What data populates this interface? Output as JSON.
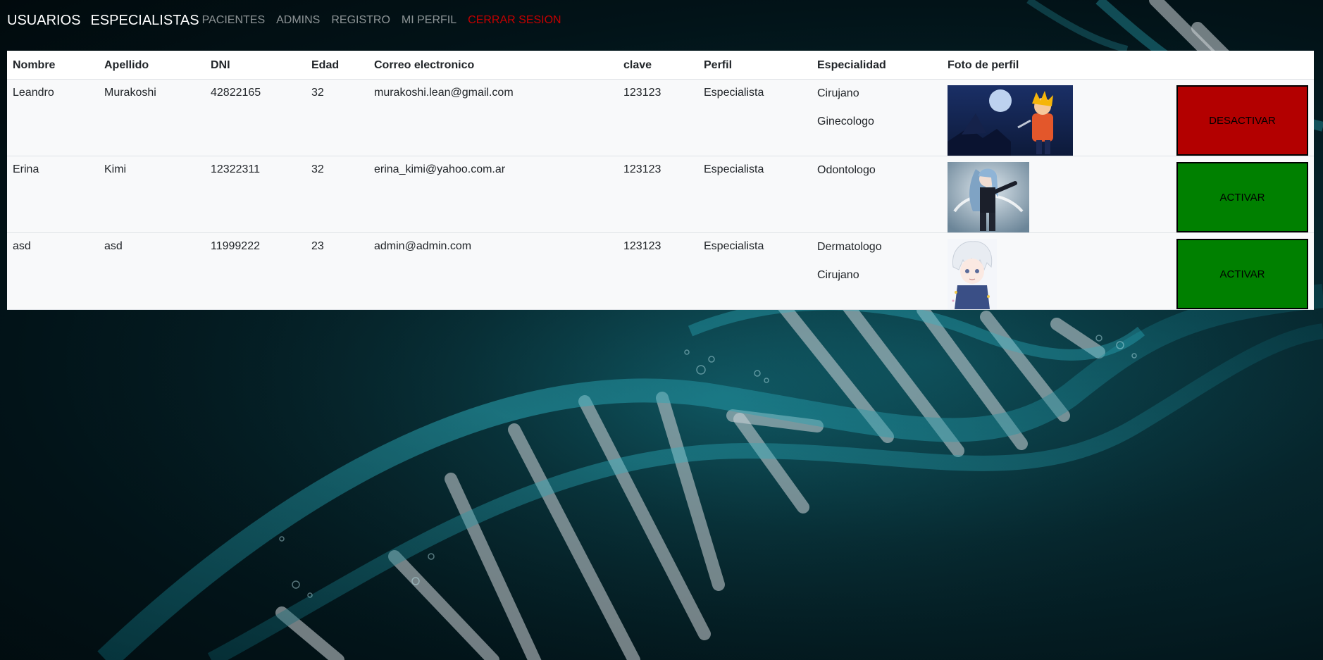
{
  "nav": {
    "brand": "USUARIOS",
    "specialists": "ESPECIALISTAS",
    "links": [
      "PACIENTES",
      "ADMINS",
      "REGISTRO",
      "MI PERFIL"
    ],
    "logout": "CERRAR SESION"
  },
  "table": {
    "headers": [
      "Nombre",
      "Apellido",
      "DNI",
      "Edad",
      "Correo electronico",
      "clave",
      "Perfil",
      "Especialidad",
      "Foto de perfil"
    ],
    "rows": [
      {
        "nombre": "Leandro",
        "apellido": "Murakoshi",
        "dni": "42822165",
        "edad": "32",
        "correo": "murakoshi.lean@gmail.com",
        "clave": "123123",
        "perfil": "Especialista",
        "especialidades": [
          "Cirujano",
          "Ginecologo"
        ],
        "photo_icon": "avatar-anime-orange-hair",
        "action": "DESACTIVAR",
        "action_color": "#b30000"
      },
      {
        "nombre": "Erina",
        "apellido": "Kimi",
        "dni": "12322311",
        "edad": "32",
        "correo": "erina_kimi@yahoo.com.ar",
        "clave": "123123",
        "perfil": "Especialista",
        "especialidades": [
          "Odontologo"
        ],
        "photo_icon": "avatar-anime-silver-hair",
        "action": "ACTIVAR",
        "action_color": "#008000"
      },
      {
        "nombre": "asd",
        "apellido": "asd",
        "dni": "11999222",
        "edad": "23",
        "correo": "admin@admin.com",
        "clave": "123123",
        "perfil": "Especialista",
        "especialidades": [
          "Dermatologo",
          "Cirujano"
        ],
        "photo_icon": "avatar-anime-white-hair",
        "action": "ACTIVAR",
        "action_color": "#008000"
      }
    ]
  },
  "colors": {
    "logout": "#c40000",
    "deactivate": "#b30000",
    "activate": "#008000",
    "background": "#021318",
    "dna_accent": "#2fb8c8"
  }
}
